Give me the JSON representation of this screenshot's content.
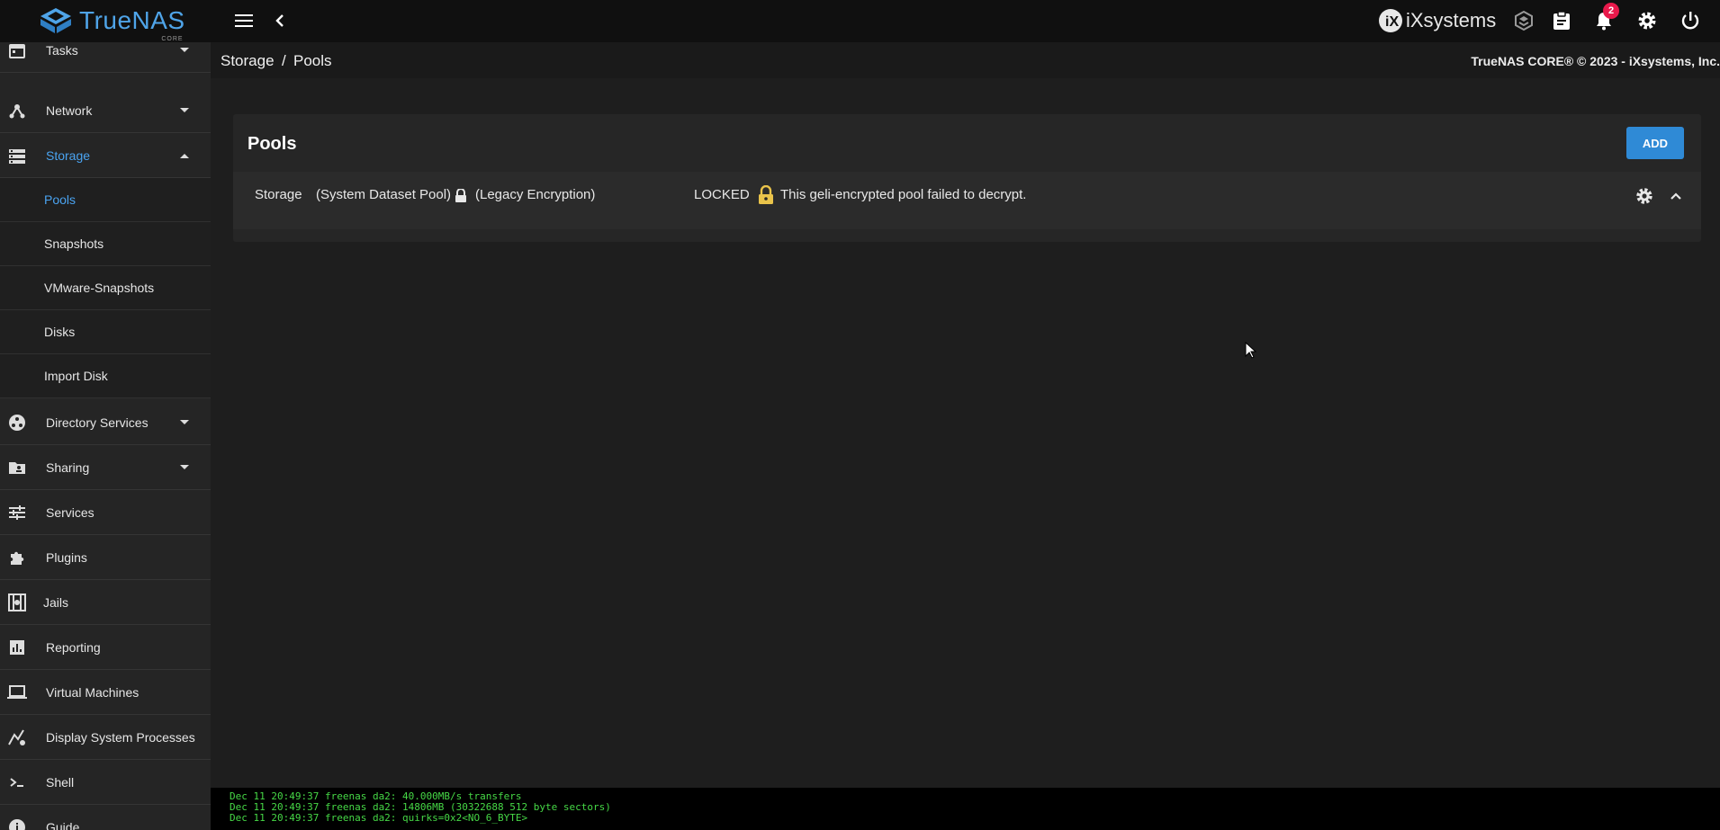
{
  "app": {
    "logo_text": "TrueNAS",
    "logo_subtext": "CORE",
    "vendor_brand": "iXsystems",
    "notification_count": "2"
  },
  "topbar": {
    "icons": [
      "menu-icon",
      "chevron-left-icon",
      "truecommand-icon",
      "clipboard-icon",
      "bell-icon",
      "gear-icon",
      "power-icon"
    ]
  },
  "sidebar": {
    "items": [
      {
        "label": "Tasks",
        "icon": "calendar-icon",
        "expanded": false
      },
      {
        "label": "Network",
        "icon": "network-icon",
        "expanded": false
      },
      {
        "label": "Storage",
        "icon": "storage-icon",
        "expanded": true
      },
      {
        "label": "Directory Services",
        "icon": "directory-icon",
        "expanded": false
      },
      {
        "label": "Sharing",
        "icon": "folder-share-icon",
        "expanded": false
      },
      {
        "label": "Services",
        "icon": "tune-icon"
      },
      {
        "label": "Plugins",
        "icon": "puzzle-icon"
      },
      {
        "label": "Jails",
        "icon": "jail-icon"
      },
      {
        "label": "Reporting",
        "icon": "chart-icon"
      },
      {
        "label": "Virtual Machines",
        "icon": "laptop-icon"
      },
      {
        "label": "Display System Processes",
        "icon": "processes-icon"
      },
      {
        "label": "Shell",
        "icon": "terminal-icon"
      },
      {
        "label": "Guide",
        "icon": "info-icon"
      }
    ],
    "storage_children": [
      {
        "label": "Pools",
        "active": true
      },
      {
        "label": "Snapshots"
      },
      {
        "label": "VMware-Snapshots"
      },
      {
        "label": "Disks"
      },
      {
        "label": "Import Disk"
      }
    ]
  },
  "breadcrumb": {
    "parent": "Storage",
    "separator": "/",
    "current": "Pools"
  },
  "copyright": "TrueNAS CORE® © 2023 - iXsystems, Inc.",
  "pools_card": {
    "title": "Pools",
    "add_label": "ADD",
    "pool": {
      "name": "Storage",
      "system_tag": "(System Dataset Pool)",
      "encryption": "(Legacy Encryption)",
      "status": "LOCKED",
      "message": "This geli-encrypted pool failed to decrypt."
    }
  },
  "console": {
    "lines": [
      "Dec 11 20:49:37 freenas da2: 40.000MB/s transfers",
      "Dec 11 20:49:37 freenas da2: 14806MB (30322688 512 byte sectors)",
      "Dec 11 20:49:37 freenas da2: quirks=0x2<NO_6_BYTE>"
    ]
  },
  "colors": {
    "accent": "#2f8ad6",
    "active_nav": "#4aa3f0",
    "lock_yellow": "#e9c34a",
    "badge": "#e8194b",
    "console_text": "#46d846"
  }
}
